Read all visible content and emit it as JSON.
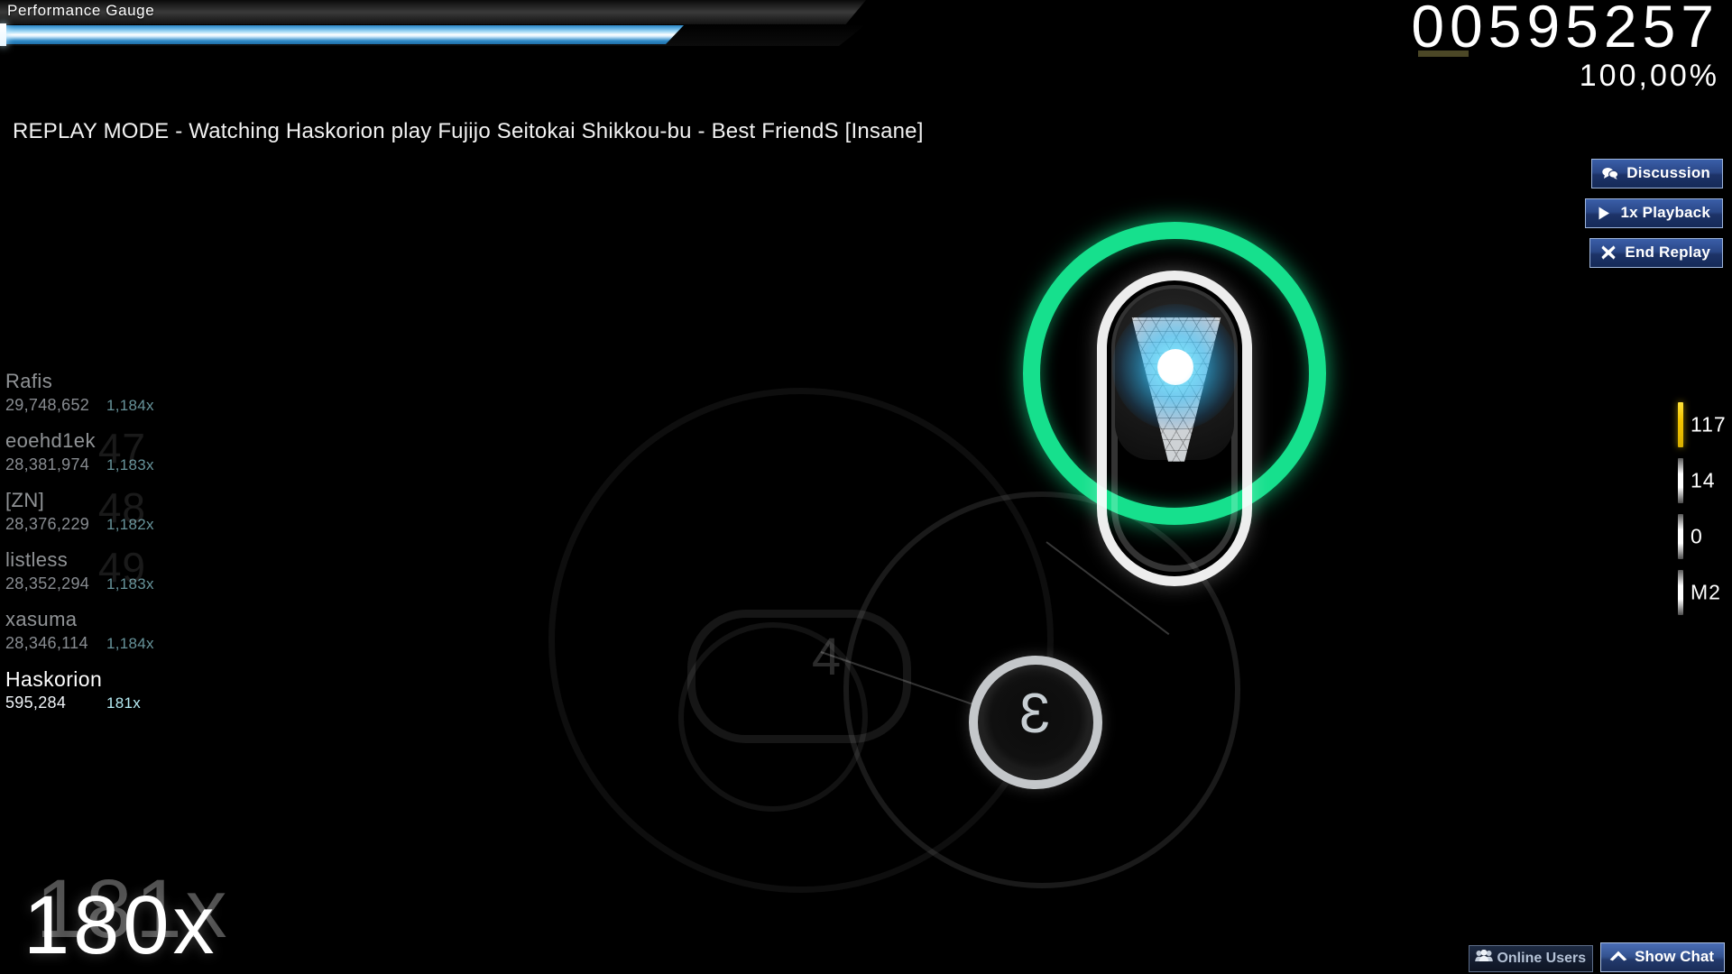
{
  "gauge": {
    "label": "Performance Gauge",
    "fill_percent": 79
  },
  "score": {
    "value": "00595257",
    "accuracy": "100,00%"
  },
  "replay": {
    "title": "REPLAY MODE - Watching Haskorion play Fujijo Seitokai Shikkou-bu - Best FriendS [Insane]",
    "buttons": [
      {
        "label": "Discussion",
        "icon": "speech-bubble-icon"
      },
      {
        "label": "1x Playback",
        "icon": "play-icon"
      },
      {
        "label": "End Replay",
        "icon": "close-x-icon"
      }
    ]
  },
  "leaderboard": [
    {
      "rank": "",
      "name": "Rafis",
      "score": "29,748,652",
      "combo": "1,184x",
      "active": false
    },
    {
      "rank": "47",
      "name": "eoehd1ek",
      "score": "28,381,974",
      "combo": "1,183x",
      "active": false
    },
    {
      "rank": "48",
      "name": "[ZN]",
      "score": "28,376,229",
      "combo": "1,182x",
      "active": false
    },
    {
      "rank": "49",
      "name": "listless",
      "score": "28,352,294",
      "combo": "1,183x",
      "active": false
    },
    {
      "rank": "",
      "name": "xasuma",
      "score": "28,346,114",
      "combo": "1,184x",
      "active": false
    },
    {
      "rank": "",
      "name": "Haskorion",
      "score": "595,284",
      "combo": "181x",
      "active": true
    }
  ],
  "combo": {
    "current": "180x",
    "previous": "181x"
  },
  "key_overlay": [
    {
      "label": "117",
      "active": true
    },
    {
      "label": "14",
      "active": false
    },
    {
      "label": "0",
      "active": false
    },
    {
      "label": "M2",
      "active": false
    }
  ],
  "chat_bar": {
    "online_users_label": "Online Users",
    "online_users_icon": "people-icon",
    "show_chat_label": "Show Chat",
    "show_chat_icon": "chevron-up-icon"
  },
  "playfield": {
    "hit_circle_number": "3",
    "faded_slider_number": "4",
    "approach_circle_color": "#16e08d",
    "slider_ball_color": "#5ae1ff"
  },
  "colors": {
    "gauge_fill": "#55a8de",
    "button_blue": "#2a4787",
    "combo_teal": "#96d7e1",
    "active_key": "#f2c400",
    "score_underline": "#4b4726"
  }
}
